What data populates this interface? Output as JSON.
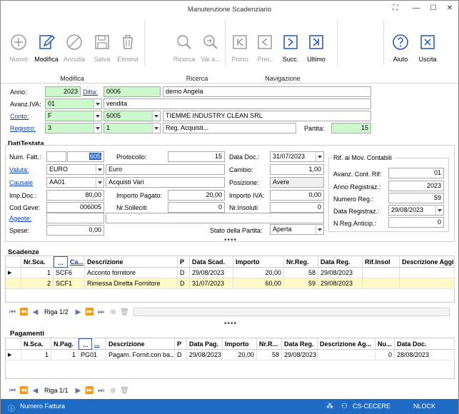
{
  "window": {
    "title": "Manutenzione Scadenziario"
  },
  "ribbon": {
    "buttons": [
      {
        "label": "Nuovo",
        "icon": "plus-circle-icon"
      },
      {
        "label": "Modifica",
        "icon": "pencil-icon"
      },
      {
        "label": "Annulla",
        "icon": "cancel-circle-icon"
      },
      {
        "label": "Salva",
        "icon": "floppy-icon"
      },
      {
        "label": "Elimina",
        "icon": "trash-icon"
      },
      {
        "label": "Ricerca",
        "icon": "magnifier-icon"
      },
      {
        "label": "Vai a...",
        "icon": "goto-magnifier-icon"
      },
      {
        "label": "Primo",
        "icon": "first-icon"
      },
      {
        "label": "Prec.",
        "icon": "prev-icon"
      },
      {
        "label": "Succ.",
        "icon": "next-icon"
      },
      {
        "label": "Ultimo",
        "icon": "last-icon"
      },
      {
        "label": "Aiuto",
        "icon": "help-icon"
      },
      {
        "label": "Uscita",
        "icon": "exit-icon"
      }
    ],
    "groups": [
      "Modifica",
      "Ricerca",
      "Navigazione"
    ]
  },
  "header": {
    "anno_label": "Anno:",
    "anno": "2023",
    "ditta_label": "Ditta:",
    "ditta_code": "0006",
    "ditta_name": "demo Angela",
    "avanz_label": "Avanz.IVA:",
    "avanz_code": "01",
    "avanz_desc": "vendita",
    "conto_label": "Conto:",
    "conto_type": "F",
    "conto_code": "6005",
    "conto_name": "TIEMME INDUSTRY CLEAN SRL",
    "registro_label": "Registro:",
    "registro_code": "3",
    "registro_num": "1",
    "registro_desc": "Reg. Acquisti...",
    "partita_label": "Partita:",
    "partita": "15"
  },
  "dati": {
    "title": "DatiTestata",
    "num_fatt_label": "Num. Fatt.:",
    "num_fatt": "605",
    "protocollo_label": "Protocollo:",
    "protocollo": "15",
    "data_doc_label": "Data Doc.:",
    "data_doc": "31/07/2023",
    "valuta_label": "Valuta:",
    "valuta": "EURO",
    "valuta_desc": "Euro",
    "cambio_label": "Cambio:",
    "cambio": "1,00",
    "causale_label": "Causale",
    "causale": "AA01",
    "causale_desc": "Acquisti Vari",
    "posizione_label": "Posizione:",
    "posizione": "Avere",
    "imp_doc_label": "Imp.Doc.:",
    "imp_doc": "80,00",
    "importo_pagato_label": "Importo Pagato:",
    "importo_pagato": "20,00",
    "importo_iva_label": "Importo IVA:",
    "importo_iva": "0,00",
    "cod_geve_label": "Cod.Geve:",
    "cod_geve": "006005",
    "nr_solleciti_label": "Nr.Solleciti",
    "nr_solleciti": "0",
    "nr_insoluti_label": "Nr.Insoluti",
    "nr_insoluti": "0",
    "agente_label": "Agente:",
    "agente": "",
    "spese_label": "Spese:",
    "spese": "0,00",
    "stato_label": "Stato della Partita:",
    "stato": "Aperta"
  },
  "rif": {
    "title": "Rif. ai Mov. Contabili",
    "avanz_label": "Avanz. Cont. Rif:",
    "avanz": "01",
    "anno_label": "Anno Registraz.:",
    "anno": "2023",
    "numero_label": "Numero Reg.:",
    "numero": "59",
    "data_label": "Data Registraz.:",
    "data": "29/08/2023",
    "anticip_label": "N.Reg.Anticip.:",
    "anticip": "0"
  },
  "scadenze": {
    "title": "Scadenze",
    "columns": [
      "Nr.Sca.",
      "...",
      "Ca...",
      "Descrizione",
      "P",
      "Data Scad.",
      "Importo",
      "Nr.Reg.",
      "Data Reg.",
      "Rif.Insol",
      "Descrizione Aggiu"
    ],
    "rows": [
      [
        "1",
        "SCF6",
        "Acconto fornitore",
        "D",
        "29/08/2023",
        "20,00",
        "58",
        "29/08/2023",
        "",
        ""
      ],
      [
        "2",
        "SCF1",
        "Rimessa Diretta Fornitore",
        "D",
        "31/07/2023",
        "60,00",
        "59",
        "29/08/2023",
        "",
        ""
      ]
    ],
    "nav": "Riga 1/2"
  },
  "pagamenti": {
    "title": "Pagamenti",
    "columns": [
      "N.Sca.",
      "N.Pag.",
      "...",
      "...",
      "Descrizione",
      "P",
      "Data Pag.",
      "Importo",
      "Nr.R...",
      "Data Reg.",
      "Descrizione Ag...",
      "Nu...",
      "Data Doc."
    ],
    "rows": [
      [
        "1",
        "1",
        "PG01",
        "Pagam. Fornit.con ba...",
        "D",
        "29/08/2023",
        "20,00",
        "58",
        "29/08/2023",
        "",
        "0",
        "28/08/2023"
      ]
    ],
    "nav": "Riga 1/1"
  },
  "statusbar": {
    "left": "Numero Fattura",
    "user": "CS-CECERE",
    "lock": "NLOCK"
  }
}
